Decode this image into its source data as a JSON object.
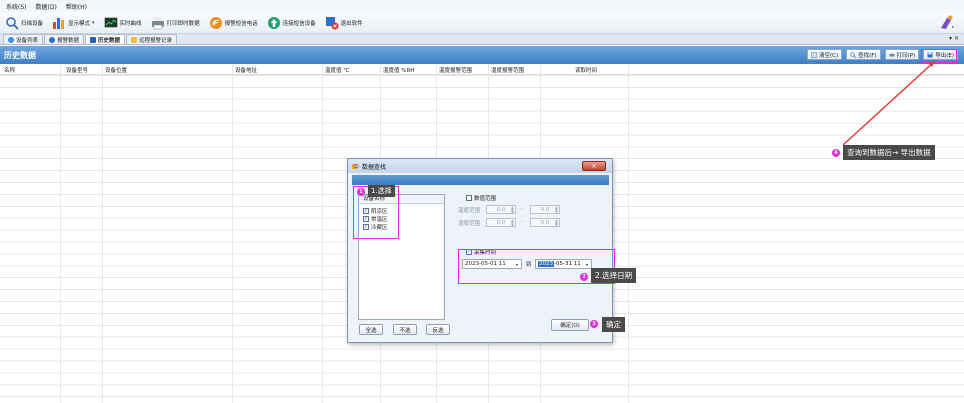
{
  "menu": [
    "系统(S)",
    "数据(D)",
    "帮助(H)"
  ],
  "toolbar": {
    "items": [
      {
        "label": "扫描设备",
        "icon": "search-icon"
      },
      {
        "label": "显示模式",
        "icon": "chart-icon",
        "dropdown": "▾"
      },
      {
        "label": "实时曲线",
        "icon": "monitor-icon"
      },
      {
        "label": "打印即时数据",
        "icon": "print-icon"
      },
      {
        "label": "报警短信电话",
        "icon": "alarm-icon"
      },
      {
        "label": "连接短信设备",
        "icon": "upload-icon"
      },
      {
        "label": "退出软件",
        "icon": "exit-icon"
      }
    ]
  },
  "tabs": [
    "设备列表",
    "报警数据",
    "历史数据",
    "远程报警记录"
  ],
  "tab_close": "▾ ✕",
  "header": {
    "title": "历史数据",
    "buttons": [
      "清空(C)",
      "查找(F)",
      "打印(P)",
      "导出(E)"
    ]
  },
  "grid_columns": [
    "名称",
    "设备型号",
    "设备位置",
    "设备地址",
    "温度值 ℃",
    "湿度值 %RH",
    "温度报警范围",
    "湿度报警范围",
    "读取时间"
  ],
  "dialog": {
    "title": "数据查找",
    "close": "✕",
    "device_header": "设备名称",
    "devices": [
      "阴凉区",
      "常温区",
      "冷藏区"
    ],
    "check_mark": "✓",
    "buttons": {
      "select_all": "全选",
      "select_none": "不选",
      "invert": "反选",
      "ok": "确定(O)"
    },
    "range_enable": "数值范围",
    "temp_range": "温度范围",
    "humidity_range": "湿度范围",
    "spin_value": "0.0",
    "range_sep": "-",
    "time_enable": "采集时间",
    "date_from": "2023-05-01 11",
    "date_to_sel": "2023",
    "date_to_rest": "-05-31 11",
    "date_to_label": "到",
    "dropdown": "▾"
  },
  "annotations": {
    "step1_num": "1",
    "step1": "1.选择",
    "step2_num": "2",
    "step2": "2.选择日期",
    "step3_num": "3",
    "step3": "确定",
    "step4_num": "4",
    "step4": "查询到数据后→ 导出数据"
  },
  "colors": {
    "annotation": "#e02de0",
    "header": "#4a86cc",
    "arrow": "#e53935"
  }
}
